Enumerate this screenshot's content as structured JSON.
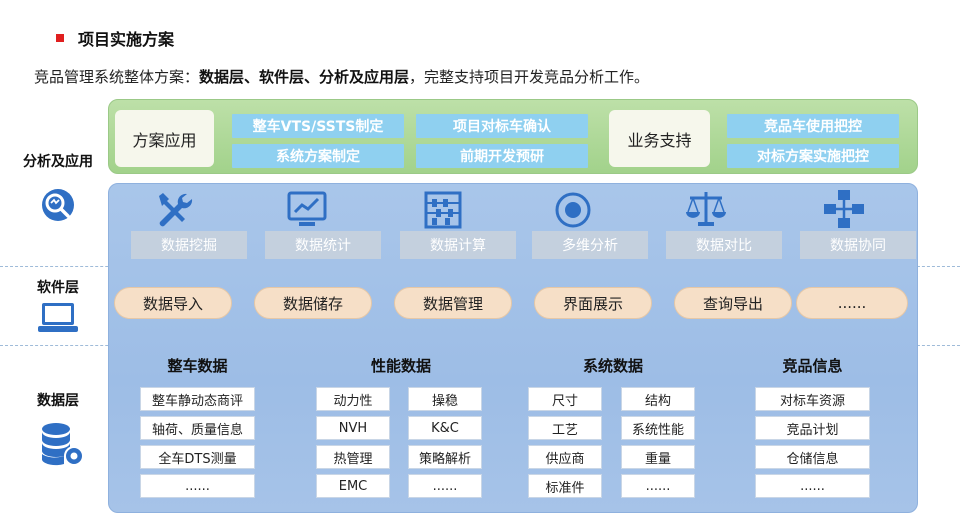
{
  "heading": "项目实施方案",
  "intro": {
    "prefix": "竞品管理系统整体方案：",
    "bold": "数据层、软件层、分析及应用层",
    "suffix": "，完整支持项目开发竞品分析工作。"
  },
  "layers": {
    "analysis": "分析及应用",
    "software": "软件层",
    "data": "数据层"
  },
  "application": {
    "plan_box": "方案应用",
    "plan_items": [
      "整车VTS/SSTS制定",
      "项目对标车确认",
      "系统方案制定",
      "前期开发预研"
    ],
    "support_box": "业务支持",
    "support_items": [
      "竞品车使用把控",
      "对标方案实施把控"
    ]
  },
  "tools": [
    {
      "label": "数据挖掘",
      "icon": "wrench-screwdriver-icon"
    },
    {
      "label": "数据统计",
      "icon": "monitor-chart-icon"
    },
    {
      "label": "数据计算",
      "icon": "abacus-icon"
    },
    {
      "label": "多维分析",
      "icon": "target-icon"
    },
    {
      "label": "数据对比",
      "icon": "balance-scale-icon"
    },
    {
      "label": "数据协同",
      "icon": "network-icon"
    }
  ],
  "software_items": [
    "数据导入",
    "数据储存",
    "数据管理",
    "界面展示",
    "查询导出",
    "......"
  ],
  "data_groups": {
    "vehicle": {
      "title": "整车数据",
      "items": [
        "整车静动态商评",
        "轴荷、质量信息",
        "全车DTS测量",
        "......"
      ]
    },
    "performance": {
      "title": "性能数据",
      "left": [
        "动力性",
        "NVH",
        "热管理",
        "EMC"
      ],
      "right": [
        "操稳",
        "K&C",
        "策略解析",
        "......"
      ]
    },
    "system": {
      "title": "系统数据",
      "left": [
        "尺寸",
        "工艺",
        "供应商",
        "标准件"
      ],
      "right": [
        "结构",
        "系统性能",
        "重量",
        "......"
      ]
    },
    "competitor": {
      "title": "竞品信息",
      "items": [
        "对标车资源",
        "竞品计划",
        "仓储信息",
        "......"
      ]
    }
  },
  "colors": {
    "accent_red": "#e01f1f",
    "green_band": "#a8d592",
    "blue_panel": "#a3c1e8",
    "button_blue": "#8fd0f0",
    "tool_label_gray": "#c4d0de",
    "pill_peach": "#f6dfc7",
    "icon_blue": "#2f6fc4"
  }
}
